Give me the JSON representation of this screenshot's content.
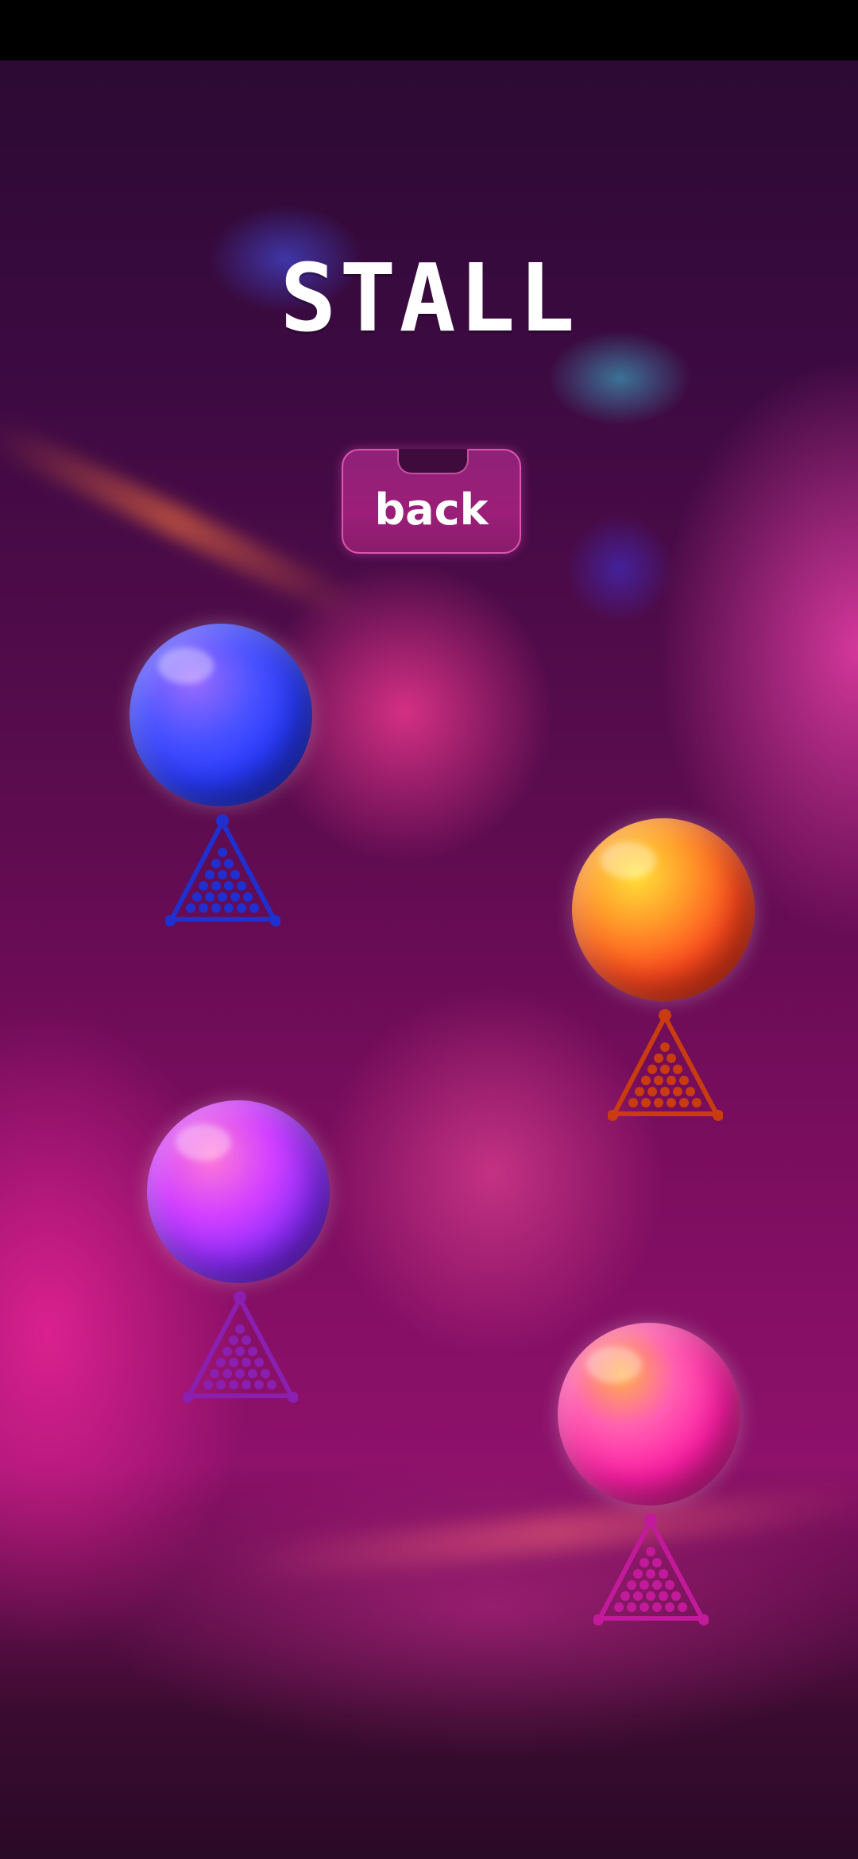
{
  "screen": {
    "title": "STALL"
  },
  "back_button": {
    "label": "back"
  },
  "balls": [
    {
      "name": "blue-ball",
      "color": "#2a3cff",
      "highlight": "#9c6cff",
      "rack_color": "#1f2fd0"
    },
    {
      "name": "orange-ball",
      "color": "#ff4a1e",
      "highlight": "#ffd23a",
      "rack_color": "#c93b10"
    },
    {
      "name": "purple-ball",
      "color": "#8a2cff",
      "highlight": "#ff5fd6",
      "rack_color": "#8a1fb0"
    },
    {
      "name": "pink-ball",
      "color": "#ff1fa6",
      "highlight": "#ff9a4a",
      "rack_color": "#c21a9a"
    }
  ]
}
